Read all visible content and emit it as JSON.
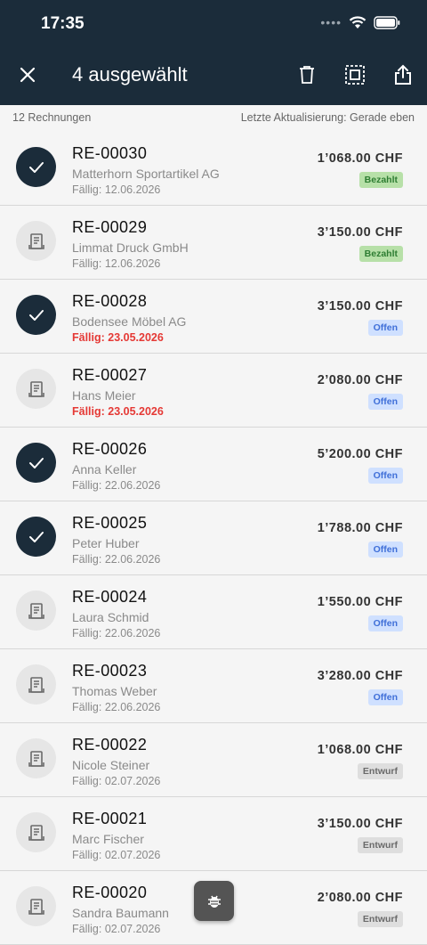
{
  "status_bar": {
    "time": "17:35"
  },
  "toolbar": {
    "title": "4 ausgewählt"
  },
  "subbar": {
    "count": "12 Rechnungen",
    "last_update": "Letzte Aktualisierung: Gerade eben"
  },
  "invoices": [
    {
      "number": "RE-00030",
      "customer": "Matterhorn Sportartikel AG",
      "due": "Fällig: 12.06.2026",
      "overdue": false,
      "amount": "1’068.00 CHF",
      "status": "Bezahlt",
      "status_type": "paid",
      "selected": true
    },
    {
      "number": "RE-00029",
      "customer": "Limmat Druck GmbH",
      "due": "Fällig: 12.06.2026",
      "overdue": false,
      "amount": "3’150.00 CHF",
      "status": "Bezahlt",
      "status_type": "paid",
      "selected": false
    },
    {
      "number": "RE-00028",
      "customer": "Bodensee Möbel AG",
      "due": "Fällig: 23.05.2026",
      "overdue": true,
      "amount": "3’150.00 CHF",
      "status": "Offen",
      "status_type": "open",
      "selected": true
    },
    {
      "number": "RE-00027",
      "customer": "Hans Meier",
      "due": "Fällig: 23.05.2026",
      "overdue": true,
      "amount": "2’080.00 CHF",
      "status": "Offen",
      "status_type": "open",
      "selected": false
    },
    {
      "number": "RE-00026",
      "customer": "Anna Keller",
      "due": "Fällig: 22.06.2026",
      "overdue": false,
      "amount": "5’200.00 CHF",
      "status": "Offen",
      "status_type": "open",
      "selected": true
    },
    {
      "number": "RE-00025",
      "customer": "Peter Huber",
      "due": "Fällig: 22.06.2026",
      "overdue": false,
      "amount": "1’788.00 CHF",
      "status": "Offen",
      "status_type": "open",
      "selected": true
    },
    {
      "number": "RE-00024",
      "customer": "Laura Schmid",
      "due": "Fällig: 22.06.2026",
      "overdue": false,
      "amount": "1’550.00 CHF",
      "status": "Offen",
      "status_type": "open",
      "selected": false
    },
    {
      "number": "RE-00023",
      "customer": "Thomas Weber",
      "due": "Fällig: 22.06.2026",
      "overdue": false,
      "amount": "3’280.00 CHF",
      "status": "Offen",
      "status_type": "open",
      "selected": false
    },
    {
      "number": "RE-00022",
      "customer": "Nicole Steiner",
      "due": "Fällig: 02.07.2026",
      "overdue": false,
      "amount": "1’068.00 CHF",
      "status": "Entwurf",
      "status_type": "draft",
      "selected": false
    },
    {
      "number": "RE-00021",
      "customer": "Marc Fischer",
      "due": "Fällig: 02.07.2026",
      "overdue": false,
      "amount": "3’150.00 CHF",
      "status": "Entwurf",
      "status_type": "draft",
      "selected": false
    },
    {
      "number": "RE-00020",
      "customer": "Sandra Baumann",
      "due": "Fällig: 02.07.2026",
      "overdue": false,
      "amount": "2’080.00 CHF",
      "status": "Entwurf",
      "status_type": "draft",
      "selected": false
    }
  ],
  "icons": {
    "close": "close-icon",
    "delete": "trash-icon",
    "select_all": "select-all-icon",
    "share": "share-icon",
    "fab": "bug-icon",
    "checked": "check-icon",
    "invoice": "receipt-icon"
  }
}
